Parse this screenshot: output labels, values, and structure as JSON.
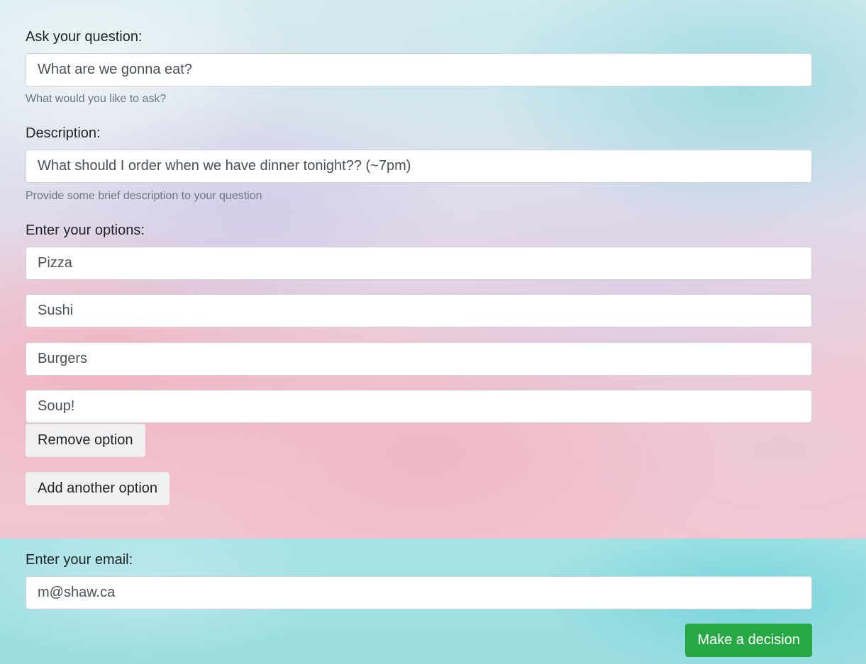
{
  "question": {
    "label": "Ask your question:",
    "value": "What are we gonna eat?",
    "help": "What would you like to ask?"
  },
  "description": {
    "label": "Description:",
    "value": "What should I order when we have dinner tonight?? (~7pm)",
    "help": "Provide some brief description to your question"
  },
  "options": {
    "label": "Enter your options:",
    "items": [
      "Pizza",
      "Sushi",
      "Burgers",
      "Soup!"
    ],
    "remove_label": "Remove option",
    "add_label": "Add another option"
  },
  "email": {
    "label": "Enter your email:",
    "value": "m@shaw.ca"
  },
  "submit_label": "Make a decision",
  "colors": {
    "success": "#28a745",
    "section_bg": "#9bdde1"
  }
}
